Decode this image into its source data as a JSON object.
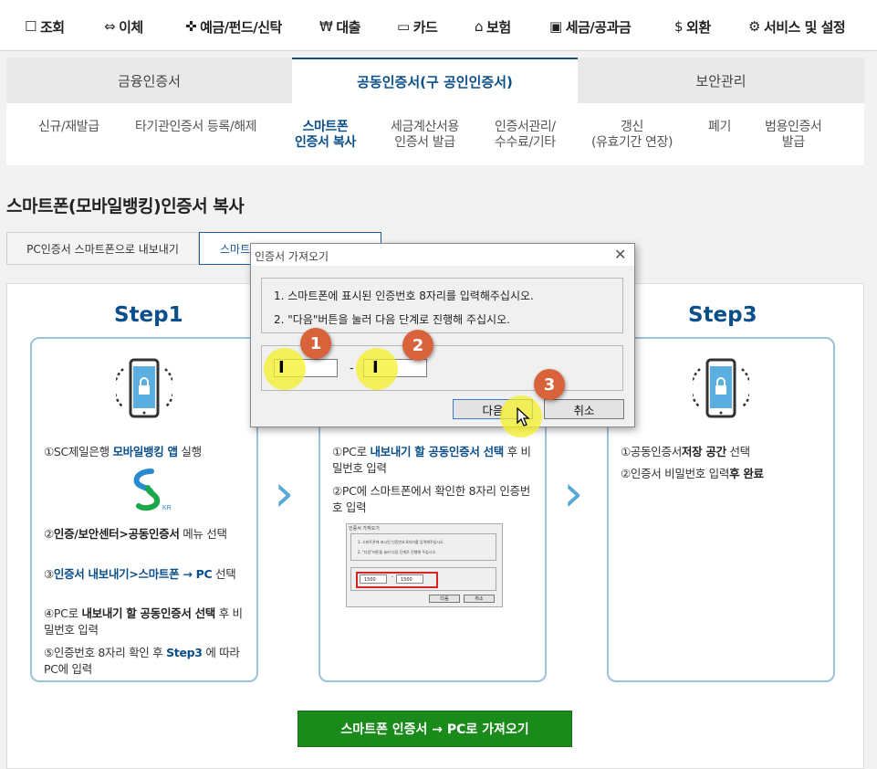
{
  "nav": [
    {
      "icon": "☐",
      "label": "조회"
    },
    {
      "icon": "⇔",
      "label": "이체"
    },
    {
      "icon": "✜",
      "label": "예금/펀드/신탁"
    },
    {
      "icon": "₩",
      "label": "대출"
    },
    {
      "icon": "▭",
      "label": "카드"
    },
    {
      "icon": "⌂",
      "label": "보험"
    },
    {
      "icon": "▣",
      "label": "세금/공과금"
    },
    {
      "icon": "$",
      "label": "외환"
    },
    {
      "icon": "⚙",
      "label": "서비스 및 설정"
    }
  ],
  "tabs": [
    "금융인증서",
    "공동인증서(구 공인인증서)",
    "보안관리"
  ],
  "submenu": [
    "신규/재발급",
    "타기관인증서 등록/해제",
    "스마트폰\n인증서 복사",
    "세금계산서용\n인증서 발급",
    "인증서관리/\n수수료/기타",
    "갱신\n(유효기간 연장)",
    "폐기",
    "범용인증서\n발급"
  ],
  "page_title": "스마트폰(모바일뱅킹)인증서 복사",
  "subtabs": [
    "PC인증서 스마트폰으로 내보내기",
    "스마트"
  ],
  "steps": {
    "step1": {
      "title": "Step1",
      "items": [
        {
          "num": "①",
          "pre": "SC제일은행 ",
          "bold": "모바일뱅킹 앱",
          "post": " 실행"
        },
        {
          "num": "②",
          "pre": "",
          "bold": "인증/보안센터>공동인증서",
          "post": " 메뉴 선택"
        },
        {
          "num": "③",
          "pre": "",
          "bold": "인증서 내보내기>스마트폰 → PC",
          "post": " 선택"
        },
        {
          "num": "④",
          "pre": "PC로 ",
          "bold": "내보내기 할 공동인증서 선택",
          "post": " 후 비밀번호 입력"
        },
        {
          "num": "⑤",
          "pre": "인증번호 8자리 확인 후 ",
          "bold": "Step3",
          "post": " 에 따라 PC에 입력"
        }
      ]
    },
    "step2": {
      "items": [
        {
          "num": "①",
          "pre": "PC로 ",
          "bold": "내보내기 할 공동인증서 선택",
          "post": " 후 비밀번호 입력"
        },
        {
          "num": "②",
          "pre": "PC에 스마트폰에서 확인한 8자리 인증번호 입력",
          "bold": "",
          "post": ""
        }
      ]
    },
    "step3": {
      "title": "Step3",
      "items": [
        {
          "num": "①",
          "pre": "공동인증서",
          "bold": "저장 공간",
          "post": " 선택"
        },
        {
          "num": "②",
          "pre": "인증서 비밀번호 입력",
          "bold": "후 완료",
          "post": ""
        }
      ]
    }
  },
  "cta_label": "스마트폰 인증서 → PC로 가져오기",
  "logo_text": "KR",
  "dialog": {
    "title": "인증서 가져오기",
    "line1": "1. 스마트폰에 표시된 인증번호 8자리를 입력해주십시오.",
    "line2": "2. \"다음\"버튼을 눌러 다음 단계로 진행해 주십시오.",
    "dash": "-",
    "next": "다음",
    "cancel": "취소"
  },
  "badges": [
    "1",
    "2",
    "3"
  ],
  "mini_dialog": {
    "title": "인증서 가져오기",
    "line1": "1. 스마트폰에 표시된 인증번호 8자리를 입력해주십시오.",
    "line2": "2. \"다음\"버튼을 눌러 다음 단계로 진행해 주십시오.",
    "input1": "1500",
    "dash": "-",
    "input2": "1500",
    "next": "다음",
    "cancel": "취소"
  },
  "colors": {
    "brand_blue": "#0a4f8a",
    "cta_green": "#1a8a1a",
    "badge_orange": "#d8623a",
    "highlight_yellow": "#f5f028"
  }
}
